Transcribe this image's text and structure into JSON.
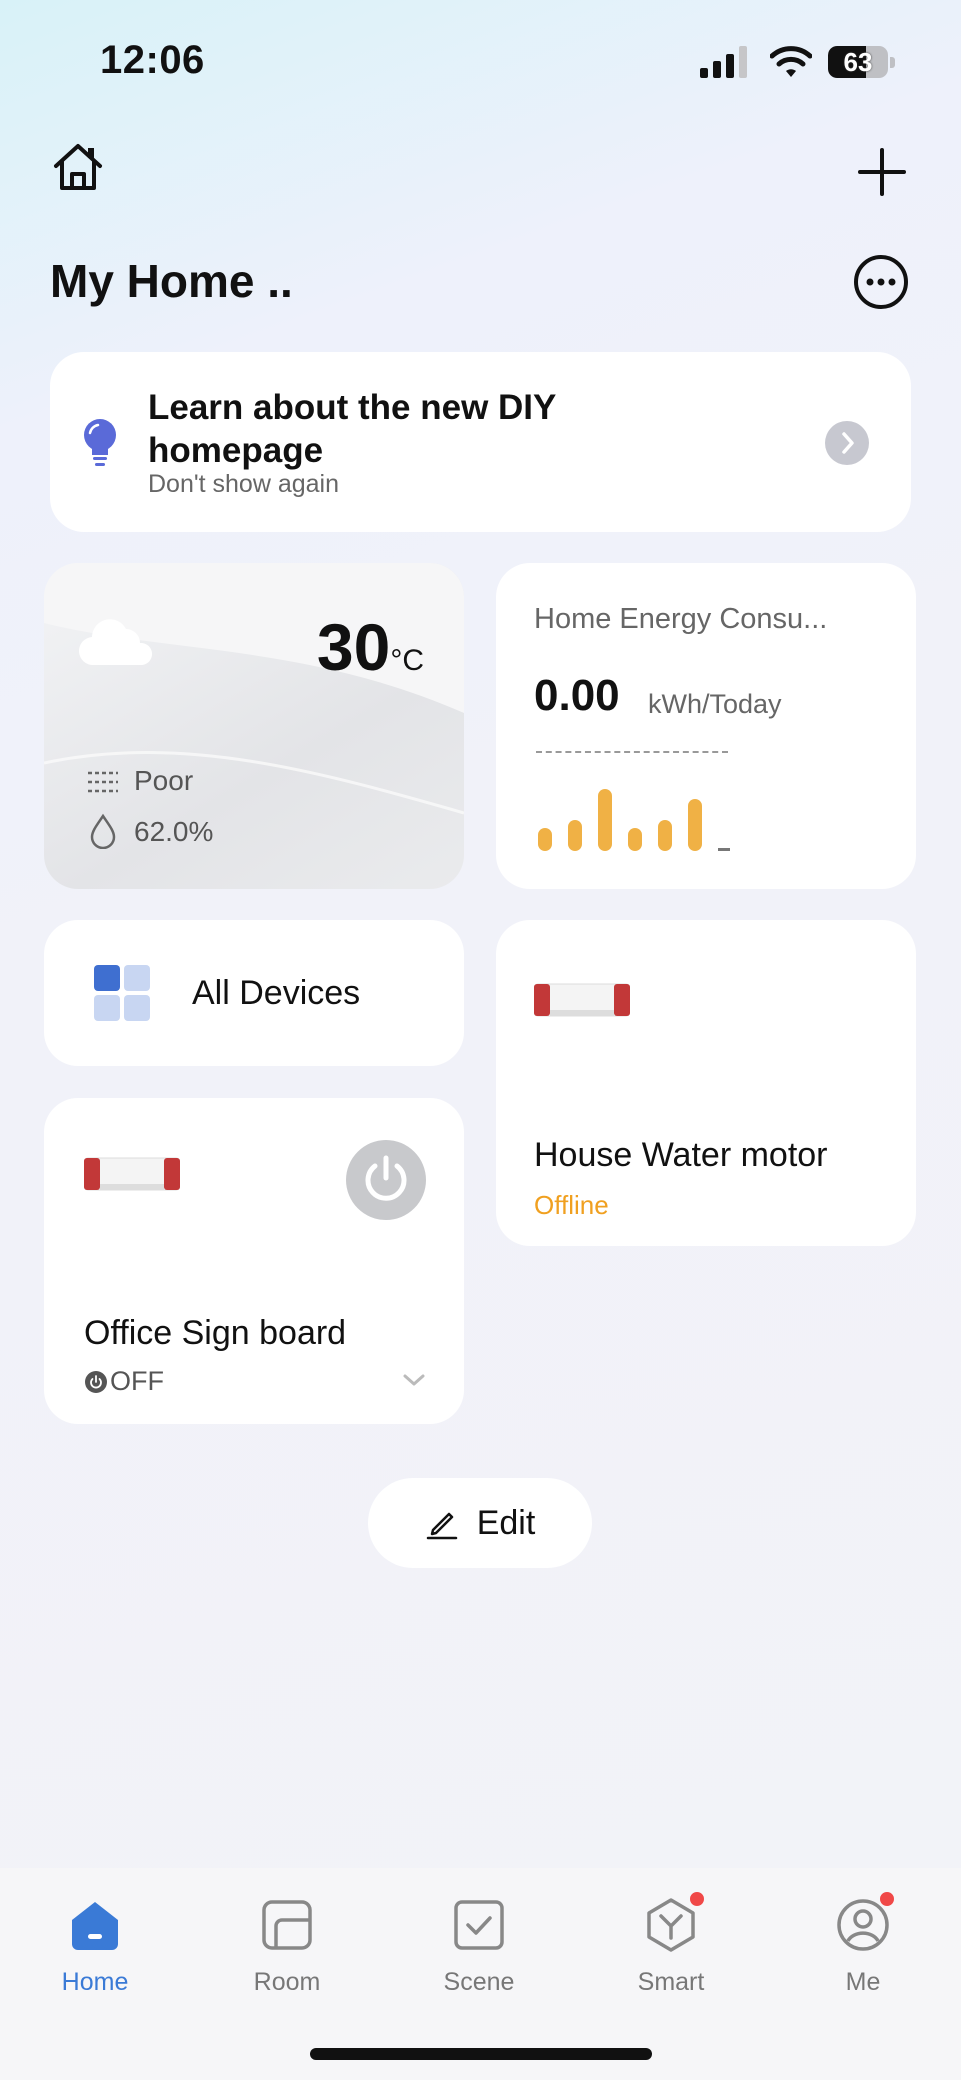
{
  "status_bar": {
    "time": "12:06",
    "battery": "63",
    "battery_level": 0.63
  },
  "header": {
    "title": "My Home .."
  },
  "banner": {
    "title": "Learn about the new DIY homepage",
    "subtitle": "Don't show again"
  },
  "weather": {
    "temperature": "30",
    "unit": "°C",
    "air_quality": "Poor",
    "humidity": "62.0%"
  },
  "energy": {
    "title": "Home Energy Consu...",
    "value": "0.00",
    "unit": "kWh/Today",
    "bar_color": "#f0b145",
    "bars_relative": [
      0.28,
      0.38,
      0.75,
      0.28,
      0.38,
      0.63
    ]
  },
  "all_devices": {
    "label": "All Devices"
  },
  "devices": [
    {
      "name": "House Water motor",
      "status": "Offline"
    },
    {
      "name": "Office Sign board",
      "status": "OFF"
    }
  ],
  "edit": {
    "label": "Edit"
  },
  "tabs": [
    {
      "label": "Home",
      "icon": "home-icon",
      "active": true
    },
    {
      "label": "Room",
      "icon": "room-icon"
    },
    {
      "label": "Scene",
      "icon": "scene-icon"
    },
    {
      "label": "Smart",
      "icon": "smart-icon",
      "badge": true
    },
    {
      "label": "Me",
      "icon": "profile-icon",
      "badge": true
    }
  ],
  "colors": {
    "accent": "#3a7ad6",
    "offline": "#f0a020",
    "badge": "#f04848"
  }
}
